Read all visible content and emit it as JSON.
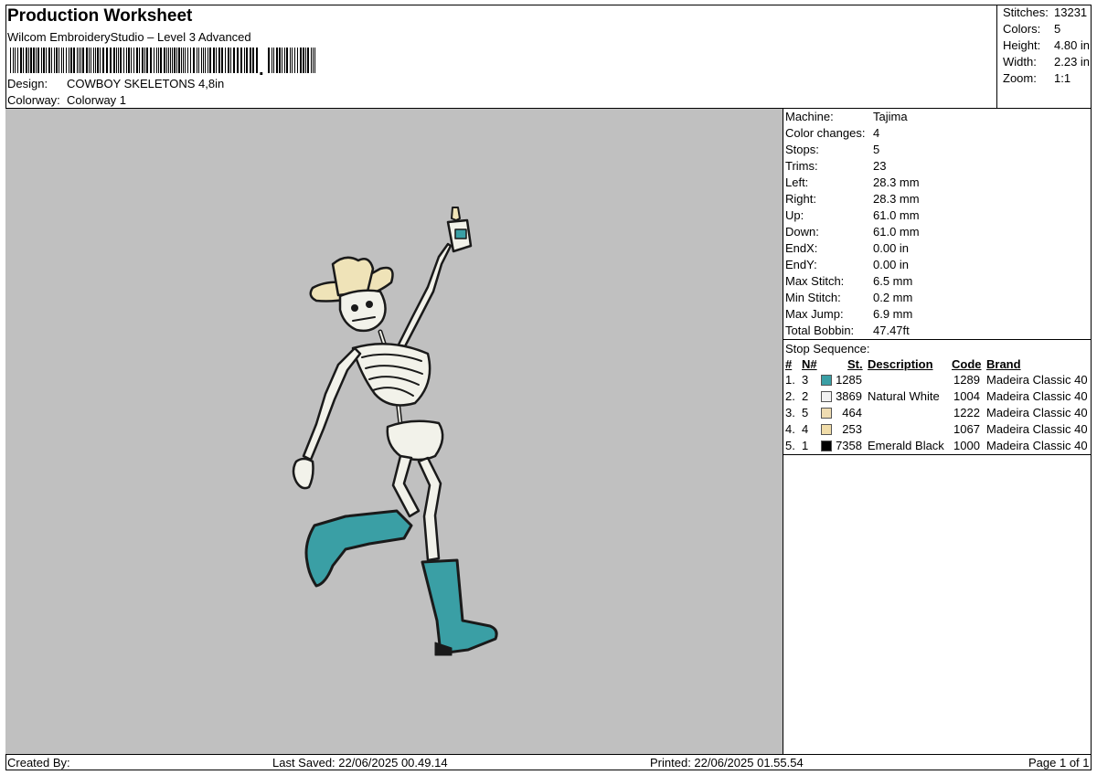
{
  "header": {
    "title": "Production Worksheet",
    "software": "Wilcom EmbroideryStudio – Level 3 Advanced",
    "design_label": "Design:",
    "design_value": "COWBOY SKELETONS 4,8in",
    "colorway_label": "Colorway:",
    "colorway_value": "Colorway 1"
  },
  "summary": {
    "stitches_label": "Stitches:",
    "stitches": "13231",
    "colors_label": "Colors:",
    "colors": "5",
    "height_label": "Height:",
    "height": "4.80 in",
    "width_label": "Width:",
    "width": "2.23 in",
    "zoom_label": "Zoom:",
    "zoom": "1:1"
  },
  "machine": [
    {
      "label": "Machine:",
      "value": "Tajima"
    },
    {
      "label": "Color changes:",
      "value": "4"
    },
    {
      "label": "Stops:",
      "value": "5"
    },
    {
      "label": "Trims:",
      "value": "23"
    },
    {
      "label": "Left:",
      "value": "28.3 mm"
    },
    {
      "label": "Right:",
      "value": "28.3 mm"
    },
    {
      "label": "Up:",
      "value": "61.0 mm"
    },
    {
      "label": "Down:",
      "value": "61.0 mm"
    },
    {
      "label": "EndX:",
      "value": "0.00 in"
    },
    {
      "label": "EndY:",
      "value": "0.00 in"
    },
    {
      "label": "Max Stitch:",
      "value": "6.5 mm"
    },
    {
      "label": "Min Stitch:",
      "value": "0.2 mm"
    },
    {
      "label": "Max Jump:",
      "value": "6.9 mm"
    },
    {
      "label": "Total Bobbin:",
      "value": "47.47ft"
    }
  ],
  "stop_sequence": {
    "title": "Stop Sequence:",
    "columns": {
      "idx": "#",
      "n": "N#",
      "st": "St.",
      "desc": "Description",
      "code": "Code",
      "brand": "Brand"
    },
    "rows": [
      {
        "idx": "1.",
        "n": "3",
        "color": "#3a9fa5",
        "st": "1285",
        "desc": "",
        "code": "1289",
        "brand": "Madeira Classic 40"
      },
      {
        "idx": "2.",
        "n": "2",
        "color": "#f2f2f2",
        "st": "3869",
        "desc": "Natural White",
        "code": "1004",
        "brand": "Madeira Classic 40"
      },
      {
        "idx": "3.",
        "n": "5",
        "color": "#efdcb2",
        "st": "464",
        "desc": "",
        "code": "1222",
        "brand": "Madeira Classic 40"
      },
      {
        "idx": "4.",
        "n": "4",
        "color": "#f0dca8",
        "st": "253",
        "desc": "",
        "code": "1067",
        "brand": "Madeira Classic 40"
      },
      {
        "idx": "5.",
        "n": "1",
        "color": "#000000",
        "st": "7358",
        "desc": "Emerald Black",
        "code": "1000",
        "brand": "Madeira Classic 40"
      }
    ]
  },
  "footer": {
    "created_by": "Created By:",
    "last_saved": "Last Saved: 22/06/2025 00.49.14",
    "printed": "Printed: 22/06/2025 01.55.54",
    "page": "Page 1 of 1"
  },
  "colors": {
    "canvas_bg": "#c0c0c0",
    "teal": "#3a9fa5",
    "hat": "#efe3b8",
    "bone": "#f2f2ea",
    "outline": "#1a1a1a"
  }
}
